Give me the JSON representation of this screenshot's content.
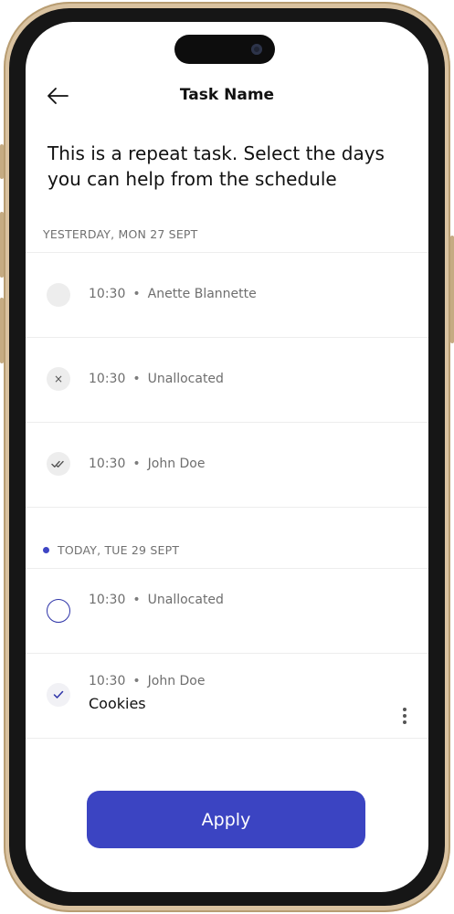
{
  "header": {
    "title": "Task Name"
  },
  "prompt": "This is a repeat task. Select the days you can help from the schedule",
  "sections": [
    {
      "heading": "YESTERDAY, MON 27 SEPT",
      "items": [
        {
          "time": "10:30",
          "separator": "•",
          "assignee": "Anette Blannette",
          "status": "empty"
        },
        {
          "time": "10:30",
          "separator": "•",
          "assignee": "Unallocated",
          "status": "declined",
          "status_glyph": "×"
        },
        {
          "time": "10:30",
          "separator": "•",
          "assignee": "John Doe",
          "status": "done"
        }
      ]
    },
    {
      "heading": "TODAY, TUE 29 SEPT",
      "items": [
        {
          "time": "10:30",
          "separator": "•",
          "assignee": "Unallocated",
          "status": "unselected"
        },
        {
          "time": "10:30",
          "separator": "•",
          "assignee": "John Doe",
          "title": "Cookies",
          "status": "selected"
        }
      ]
    }
  ],
  "actions": {
    "apply_label": "Apply"
  },
  "colors": {
    "accent": "#3b44c2",
    "today_dot": "#3e45c4"
  }
}
